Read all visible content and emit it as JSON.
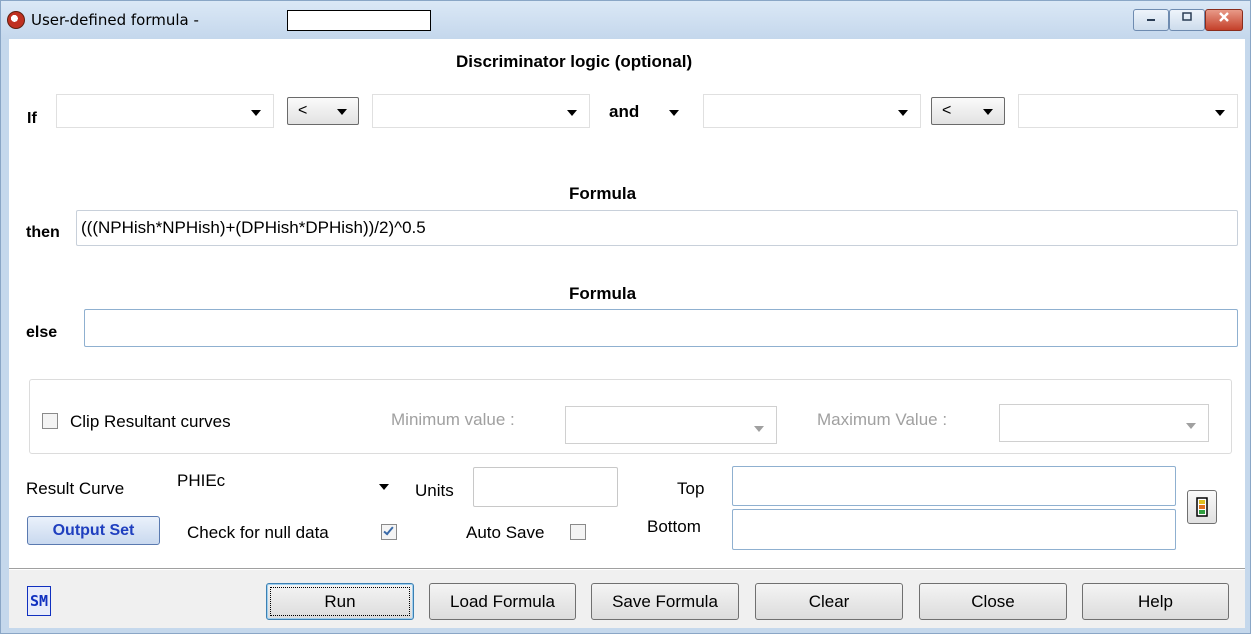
{
  "window": {
    "title": "User-defined formula  -",
    "controls": [
      "minimize",
      "maximize",
      "close"
    ]
  },
  "discriminator": {
    "heading": "Discriminator logic (optional)",
    "if_label": "If",
    "operator1": "<",
    "conjunction": "and",
    "operator2": "<",
    "field1": "",
    "field2": "",
    "field3": "",
    "field4": ""
  },
  "then_section": {
    "heading": "Formula",
    "label": "then",
    "formula": "(((NPHish*NPHish)+(DPHish*DPHish))/2)^0.5"
  },
  "else_section": {
    "heading": "Formula",
    "label": "else",
    "formula": ""
  },
  "clip": {
    "label": "Clip Resultant curves",
    "checked": false,
    "min_label": "Minimum value :",
    "max_label": "Maximum Value :",
    "min_value": "",
    "max_value": ""
  },
  "result": {
    "curve_label": "Result Curve",
    "curve_value": "PHIEc",
    "units_label": "Units",
    "units_value": "",
    "top_label": "Top",
    "top_value": "",
    "bottom_label": "Bottom",
    "bottom_value": "",
    "output_set_label": "Output Set",
    "null_check_label": "Check for null data",
    "null_check_checked": true,
    "auto_save_label": "Auto Save",
    "auto_save_checked": false
  },
  "buttons": {
    "sm": "SM",
    "run": "Run",
    "load": "Load Formula",
    "save": "Save Formula",
    "clear": "Clear",
    "close": "Close",
    "help": "Help"
  },
  "colors": {
    "titlebar": "#c4d7ec",
    "output_set_text": "#1f3fbf",
    "sm_text": "#1030c0",
    "close_button": "#c4402a"
  }
}
